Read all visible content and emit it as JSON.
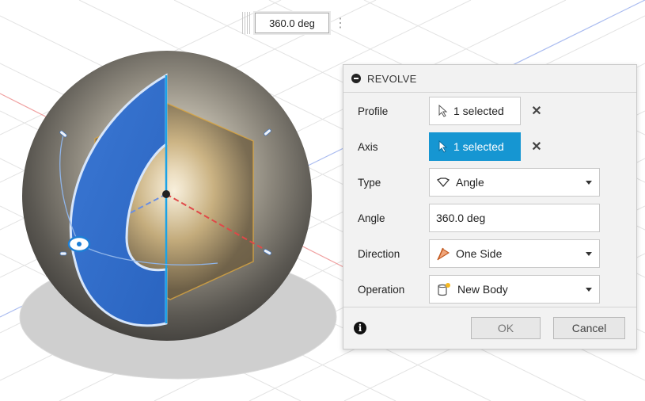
{
  "manipulator": {
    "value": "360.0 deg"
  },
  "dialog": {
    "title": "REVOLVE",
    "rows": {
      "profile": {
        "label": "Profile",
        "value": "1 selected"
      },
      "axis": {
        "label": "Axis",
        "value": "1 selected"
      },
      "type": {
        "label": "Type",
        "value": "Angle"
      },
      "angle": {
        "label": "Angle",
        "value": "360.0 deg"
      },
      "direction": {
        "label": "Direction",
        "value": "One Side"
      },
      "operation": {
        "label": "Operation",
        "value": "New Body"
      }
    },
    "buttons": {
      "ok": "OK",
      "cancel": "Cancel"
    }
  },
  "colors": {
    "accent": "#1696d2",
    "profile_fill": "#3a7fd6",
    "body": "#6e6b63",
    "axis_red": "#e05050",
    "axis_blue": "#6b8fe0"
  }
}
